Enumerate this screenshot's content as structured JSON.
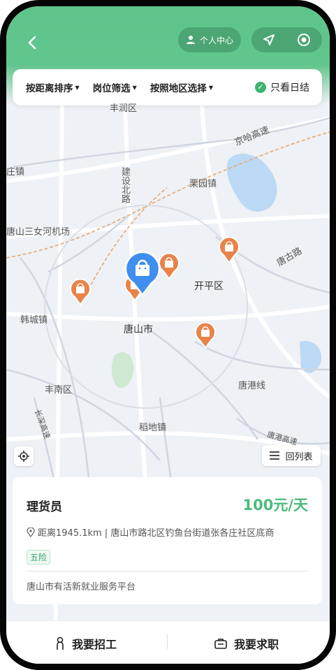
{
  "header": {
    "back_icon": "chevron-left-icon",
    "user_center_label": "个人中心",
    "nav_icon": "navigation-arrow-icon",
    "target_icon": "target-icon"
  },
  "filters": {
    "sort_label": "按距离排序",
    "position_label": "岗位筛选",
    "region_label": "按照地区选择",
    "only_daily_label": "只看日结"
  },
  "map": {
    "labels": [
      "丰润区",
      "京哈高速",
      "庄镇",
      "建设北路",
      "栗园镇",
      "唐山三女河机场",
      "唐古路",
      "开平区",
      "韩城镇",
      "唐山市",
      "唐港线",
      "丰南区",
      "长深高速",
      "稻地镇",
      "唐港高速"
    ],
    "list_button_label": "回列表"
  },
  "job": {
    "title": "理货员",
    "salary": "100元/天",
    "address": "距离1945.1km | 唐山市路北区钓鱼台街道张各庄社区底商",
    "tag": "五险",
    "platform": "唐山市有活新就业服务平台"
  },
  "bottom_nav": {
    "recruit_label": "我要招工",
    "seek_label": "我要求职"
  },
  "colors": {
    "brand_green": "#5dc48a",
    "salary_green": "#4cba7c",
    "marker_blue": "#3f8ef0",
    "marker_orange": "#e9834a"
  }
}
